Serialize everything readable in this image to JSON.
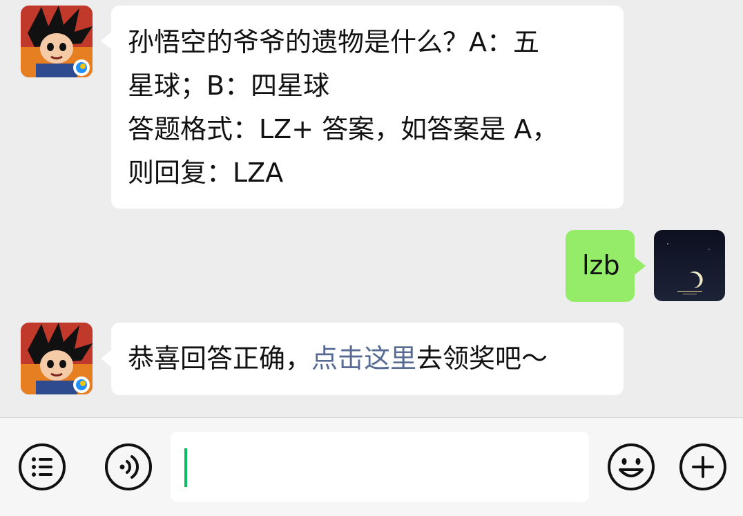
{
  "messages": [
    {
      "sender": "official-account",
      "avatar_icon": "goku-game-avatar-icon",
      "lines": [
        "孙悟空的爷爷的遗物是什么？A：五",
        "星球；B：四星球",
        "答题格式：LZ+ 答案，如答案是 A，",
        "则回复：LZA"
      ]
    },
    {
      "sender": "self",
      "avatar_icon": "moon-night-avatar-icon",
      "text": "lzb"
    },
    {
      "sender": "official-account",
      "avatar_icon": "goku-game-avatar-icon",
      "prefix": "恭喜回答正确，",
      "link": "点击这里",
      "suffix": "去领奖吧～"
    }
  ],
  "toolbar": {
    "menu_icon": "list-menu-icon",
    "voice_icon": "voice-icon",
    "emoji_icon": "emoji-icon",
    "plus_icon": "plus-icon",
    "input_value": ""
  },
  "colors": {
    "background": "#ededed",
    "incoming_bubble": "#ffffff",
    "outgoing_bubble": "#95ec69",
    "link": "#576b95",
    "caret": "#07c160"
  }
}
